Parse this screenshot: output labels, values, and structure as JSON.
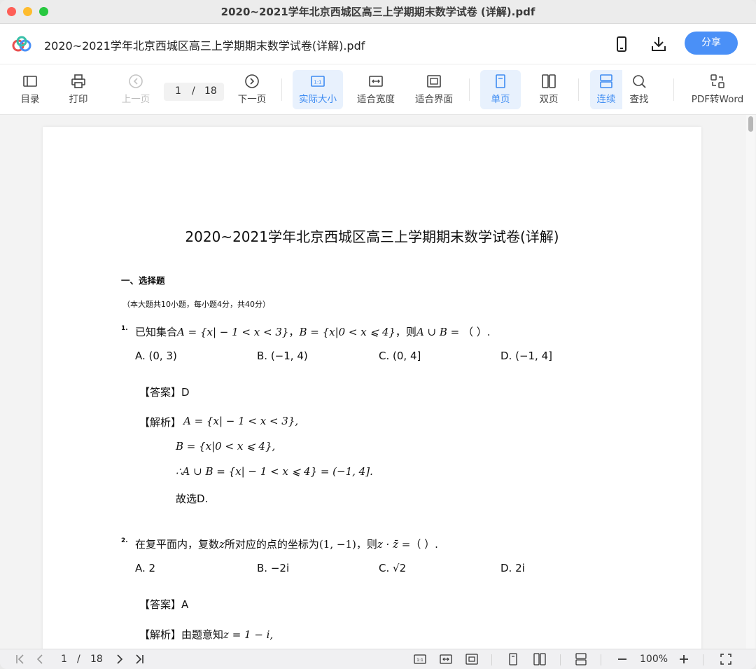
{
  "window": {
    "title": "2020~2021学年北京西城区高三上学期期末数学试卷 (详解).pdf"
  },
  "header": {
    "doc_title": "2020~2021学年北京西城区高三上学期期末数学试卷(详解).pdf",
    "share_label": "分享",
    "icons": [
      "mobile-icon",
      "download-icon"
    ]
  },
  "toolbar": {
    "toc": "目录",
    "print": "打印",
    "prev": "上一页",
    "page_current": "1",
    "page_sep": "/",
    "page_total": "18",
    "next": "下一页",
    "actual_size": "实际大小",
    "fit_width": "适合宽度",
    "fit_page": "适合界面",
    "single_page": "单页",
    "double_page": "双页",
    "continuous": "连续",
    "find": "查找",
    "pdf_to_word": "PDF转Word",
    "accent": "#3d8bf2"
  },
  "document": {
    "title": "2020~2021学年北京西城区高三上学期期末数学试卷(详解)",
    "section": "一、选择题",
    "note": "（本大题共10小题，每小题4分，共40分）",
    "q1": {
      "num": "1.",
      "stem_a": "已知集合",
      "stem_b": "A = {x| − 1 < x < 3}",
      "stem_c": "，",
      "stem_d": "B = {x|0 < x ⩽ 4}",
      "stem_e": "，则",
      "stem_f": "A ∪ B",
      "stem_g": " = （   ）.",
      "options": [
        "A. (0, 3)",
        "B. (−1, 4)",
        "C. (0, 4]",
        "D. (−1, 4]"
      ],
      "answer": "【答案】D",
      "analysis_label": "【解析】",
      "analysis_1": "A = {x| − 1 < x < 3},",
      "analysis_2": "B = {x|0 < x ⩽ 4},",
      "analysis_3": "∴A ∪ B = {x| − 1 < x ⩽ 4} = (−1, 4].",
      "analysis_4": "故选D."
    },
    "q2": {
      "num": "2.",
      "stem_a": "在复平面内，复数",
      "stem_b": "z",
      "stem_c": "所对应的点的坐标为",
      "stem_d": "(1, −1)",
      "stem_e": "，则",
      "stem_f": "z · z̄ =",
      "stem_g": "（   ）.",
      "options": [
        "A. 2",
        "B. −2i",
        "C. √2",
        "D. 2i"
      ],
      "answer": "【答案】A",
      "analysis_label": "【解析】",
      "analysis_1": "由题意知",
      "analysis_2": "z = 1 − i,"
    }
  },
  "bottombar": {
    "page_current": "1",
    "page_sep": "/",
    "page_total": "18",
    "zoom": "100%"
  }
}
